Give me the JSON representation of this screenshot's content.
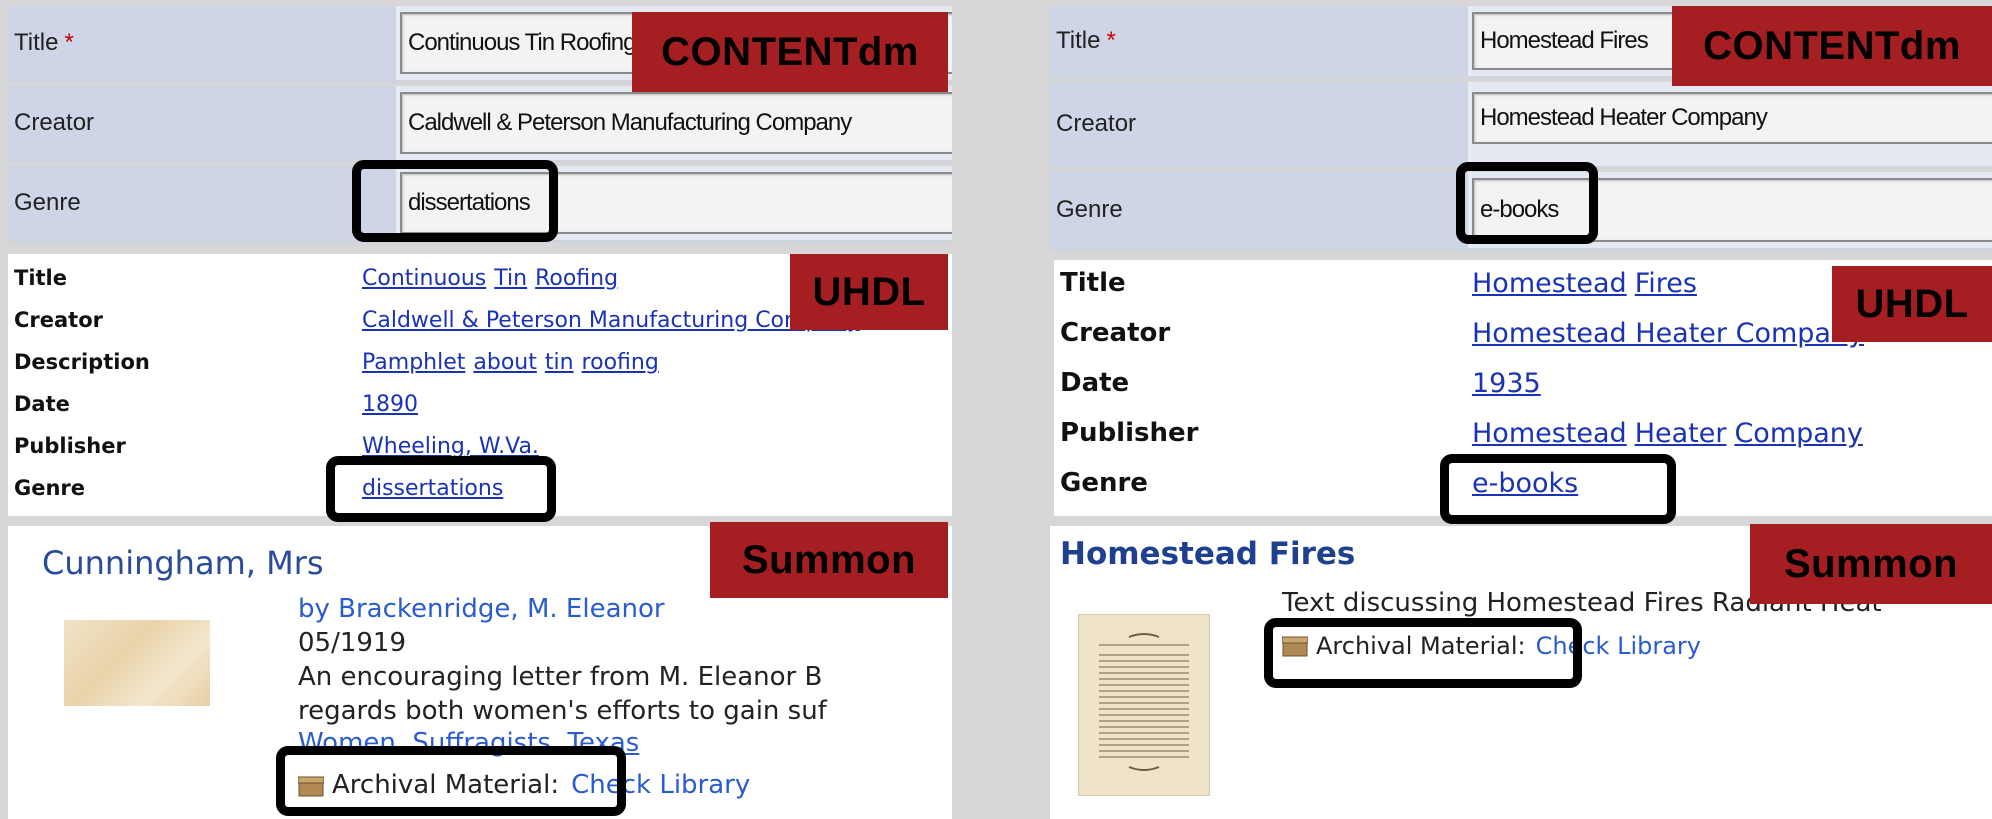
{
  "brands": {
    "contentdm": "CONTENTdm",
    "uhdl": "UHDL",
    "summon": "Summon"
  },
  "colors": {
    "brand_red": "#a51e22",
    "link_blue": "#1a33b5",
    "label_bg": "#cdd5e6"
  },
  "left": {
    "contentdm": {
      "title_label": "Title",
      "required_mark": "*",
      "title_value": "Continuous Tin Roofing",
      "creator_label": "Creator",
      "creator_value": "Caldwell & Peterson Manufacturing Company",
      "genre_label": "Genre",
      "genre_value": "dissertations"
    },
    "uhdl": {
      "title_label": "Title",
      "title_words": [
        "Continuous",
        "Tin",
        "Roofing"
      ],
      "creator_label": "Creator",
      "creator_value": "Caldwell & Peterson Manufacturing Company",
      "description_label": "Description",
      "description_words": [
        "Pamphlet",
        "about",
        "tin",
        "roofing"
      ],
      "date_label": "Date",
      "date_value": "1890",
      "publisher_label": "Publisher",
      "publisher_value": "Wheeling, W.Va.",
      "genre_label": "Genre",
      "genre_value": "dissertations"
    },
    "summon": {
      "title": "Cunningham, Mrs",
      "byline": "by Brackenridge, M. Eleanor",
      "date": "05/1919",
      "snippet_1": "An encouraging letter from M. Eleanor B",
      "snippet_2": "regards both women's efforts to gain suf",
      "subjects": "Women, Suffragists, Texas",
      "format_label": "Archival Material:",
      "check_label": "Check Library"
    }
  },
  "right": {
    "contentdm": {
      "title_label": "Title",
      "required_mark": "*",
      "title_value": "Homestead Fires",
      "creator_label": "Creator",
      "creator_value": "Homestead Heater Company",
      "genre_label": "Genre",
      "genre_value": "e-books"
    },
    "uhdl": {
      "title_label": "Title",
      "title_words": [
        "Homestead",
        "Fires"
      ],
      "creator_label": "Creator",
      "creator_value": "Homestead Heater Company",
      "date_label": "Date",
      "date_value": "1935",
      "publisher_label": "Publisher",
      "publisher_words": [
        "Homestead",
        "Heater",
        "Company"
      ],
      "genre_label": "Genre",
      "genre_value": "e-books"
    },
    "summon": {
      "title": "Homestead Fires",
      "snippet": "Text discussing Homestead Fires Radiant Heat",
      "format_label": "Archival Material:",
      "check_label": "Check Library"
    }
  }
}
